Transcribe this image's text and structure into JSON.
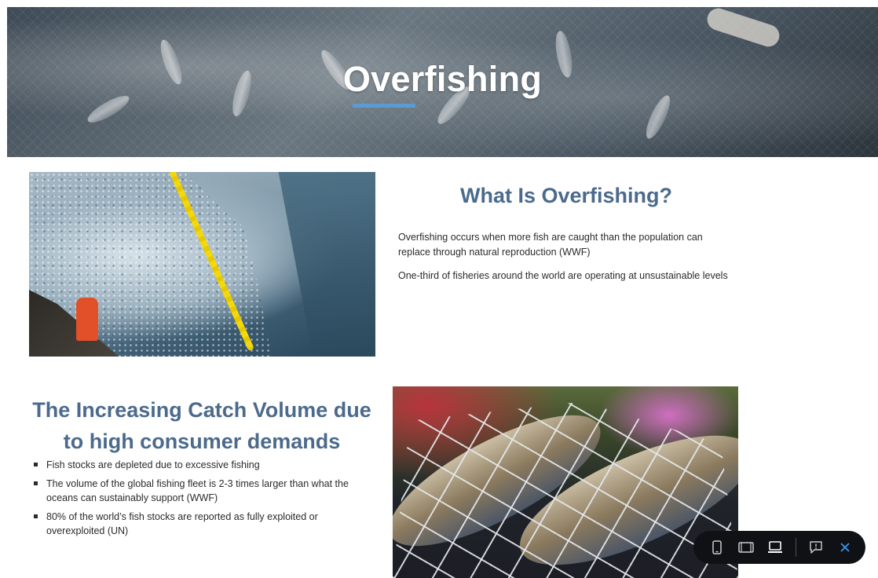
{
  "hero": {
    "title": "Overfishing"
  },
  "section_what": {
    "title": "What Is Overfishing?",
    "paragraphs": [
      "Overfishing occurs when more fish are caught than the population can replace through natural reproduction (WWF)",
      "One-third of fisheries around the world are operating at unsustainable levels"
    ]
  },
  "section_catch": {
    "title": "The Increasing Catch Volume due to high consumer demands",
    "bullets": [
      "Fish stocks are depleted due to excessive fishing",
      "The  volume of the global fishing fleet is 2-3 times larger than what the oceans can sustainably support (WWF)",
      "80% of the world’s fish stocks are reported as fully exploited or overexploited (UN)"
    ]
  },
  "toolbar": {
    "buttons": [
      "phone-view-icon",
      "tablet-view-icon",
      "desktop-view-icon",
      "feedback-icon",
      "close-icon"
    ],
    "active": "desktop-view-icon"
  },
  "colors": {
    "heading": "#4b6a8c",
    "hero_underline": "#5b9bd5",
    "toolbar_bg": "#0f1115",
    "close_accent": "#3b97f0"
  }
}
